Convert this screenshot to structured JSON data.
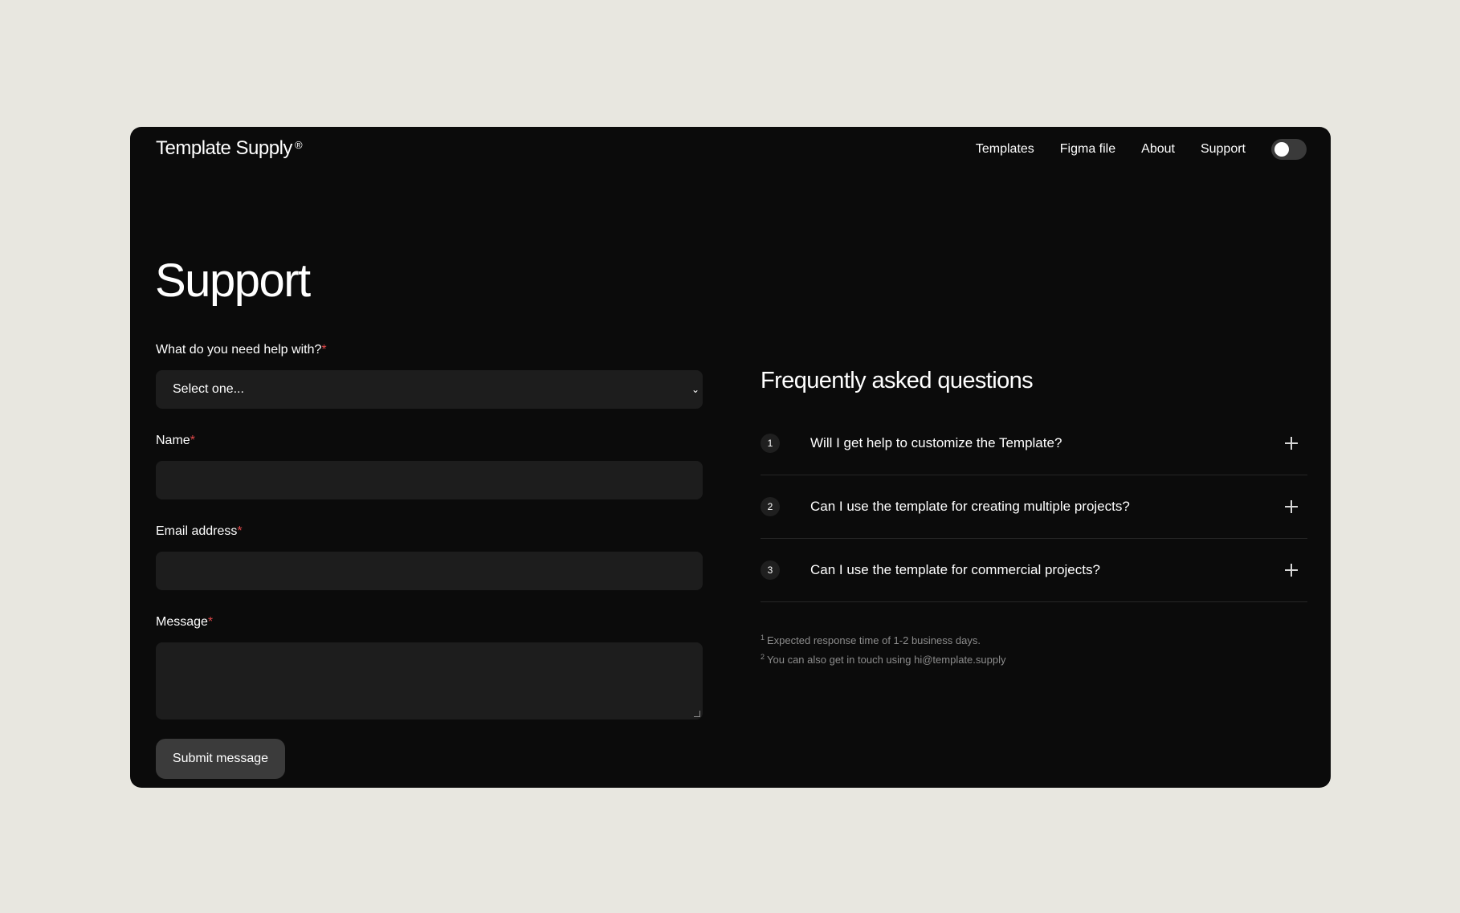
{
  "brand": {
    "name": "Template Supply",
    "mark": "®"
  },
  "nav": {
    "items": [
      "Templates",
      "Figma file",
      "About",
      "Support"
    ],
    "theme_toggle": "off"
  },
  "page": {
    "title": "Support"
  },
  "form": {
    "topic": {
      "label": "What do you need help with?",
      "required_mark": "*",
      "selected": "Select one..."
    },
    "name": {
      "label": "Name",
      "required_mark": "*",
      "value": ""
    },
    "email": {
      "label": "Email address",
      "required_mark": "*",
      "value": ""
    },
    "message": {
      "label": "Message",
      "required_mark": "*",
      "value": ""
    },
    "submit_label": "Submit message"
  },
  "faq": {
    "title": "Frequently asked questions",
    "items": [
      {
        "number": "1",
        "question": "Will I get help to customize the Template?"
      },
      {
        "number": "2",
        "question": "Can I use the template for creating multiple projects?"
      },
      {
        "number": "3",
        "question": "Can I use the template for commercial projects?"
      }
    ],
    "notes": [
      {
        "marker": "1",
        "text": "Expected response time of 1-2 business days."
      },
      {
        "marker": "2",
        "text": "You can also get in touch using hi@template.supply"
      }
    ]
  },
  "colors": {
    "page_background": "#e8e7e0",
    "window_background": "#0b0b0b",
    "field_background": "#1d1d1d",
    "button_background": "#3b3b3b",
    "required_accent": "#e0484a",
    "muted_text": "#8c8c8c"
  }
}
